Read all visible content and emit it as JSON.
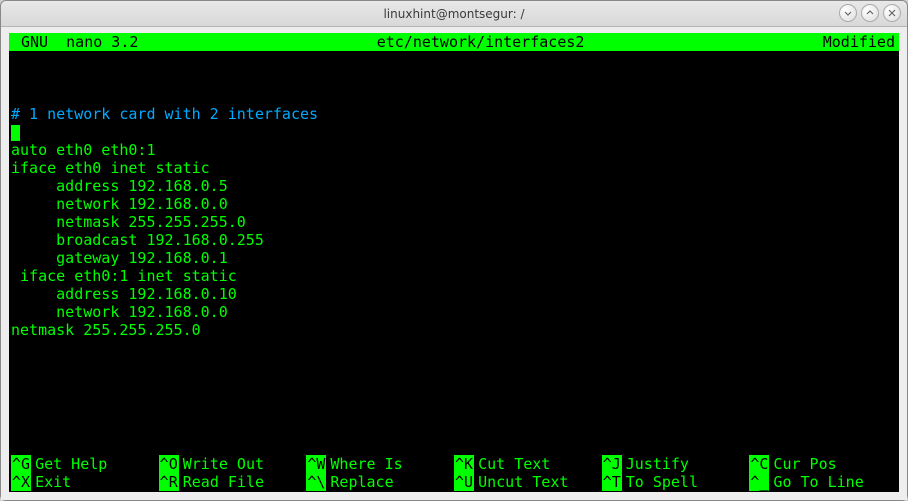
{
  "window": {
    "title": "linuxhint@montsegur: /"
  },
  "nano": {
    "version": "GNU  nano 3.2",
    "file": "etc/network/interfaces2",
    "status": "Modified"
  },
  "editor": {
    "blank_top_lines": 3,
    "comment": "# 1 network card with 2 interfaces",
    "lines": [
      "auto eth0 eth0:1",
      "iface eth0 inet static",
      "     address 192.168.0.5",
      "     network 192.168.0.0",
      "     netmask 255.255.255.0",
      "     broadcast 192.168.0.255",
      "     gateway 192.168.0.1",
      " iface eth0:1 inet static",
      "     address 192.168.0.10",
      "     network 192.168.0.0",
      "netmask 255.255.255.0"
    ]
  },
  "shortcuts": {
    "row1": [
      {
        "key": "^G",
        "label": "Get Help"
      },
      {
        "key": "^O",
        "label": "Write Out"
      },
      {
        "key": "^W",
        "label": "Where Is"
      },
      {
        "key": "^K",
        "label": "Cut Text"
      },
      {
        "key": "^J",
        "label": "Justify"
      },
      {
        "key": "^C",
        "label": "Cur Pos"
      }
    ],
    "row2": [
      {
        "key": "^X",
        "label": "Exit"
      },
      {
        "key": "^R",
        "label": "Read File"
      },
      {
        "key": "^\\",
        "label": "Replace"
      },
      {
        "key": "^U",
        "label": "Uncut Text"
      },
      {
        "key": "^T",
        "label": "To Spell"
      },
      {
        "key": "^_",
        "label": "Go To Line"
      }
    ]
  }
}
